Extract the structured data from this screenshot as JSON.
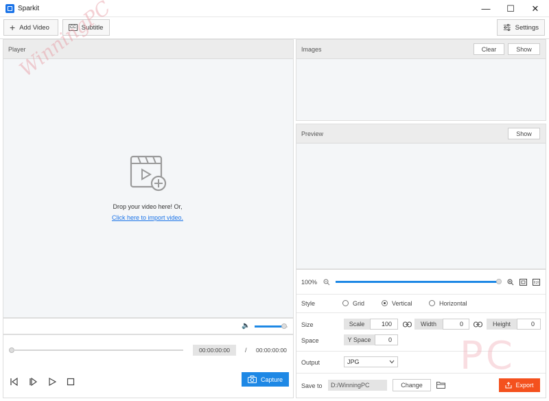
{
  "window": {
    "title": "Sparkit",
    "minimize": "—",
    "maximize": "☐",
    "close": "✕"
  },
  "toolbar": {
    "add_video": "Add Video",
    "subtitle": "Subtitle",
    "settings": "Settings"
  },
  "player": {
    "title": "Player",
    "drop_text": "Drop your video here! Or,",
    "import_link": "Click here to import video.",
    "current_time": "00:00:00:00",
    "separator": "/",
    "total_time": "00:00:00:00",
    "capture": "Capture",
    "volume_level": 0.9,
    "seek_progress": 0
  },
  "images": {
    "title": "Images",
    "clear": "Clear",
    "show": "Show"
  },
  "preview": {
    "title": "Preview",
    "show": "Show",
    "zoom": "100%",
    "zoom_level": 1.0
  },
  "settings": {
    "style_label": "Style",
    "style_options": [
      "Grid",
      "Vertical",
      "Horizontal"
    ],
    "style_selected": "Vertical",
    "size_label": "Size",
    "scale_label": "Scale",
    "scale_value": "100",
    "width_label": "Width",
    "width_value": "0",
    "height_label": "Height",
    "height_value": "0",
    "space_label": "Space",
    "yspace_label": "Y Space",
    "yspace_value": "0",
    "output_label": "Output",
    "output_value": "JPG",
    "saveto_label": "Save to",
    "saveto_value": "D:/WinningPC",
    "change": "Change",
    "export": "Export"
  },
  "watermarks": {
    "text": "WinningPC",
    "logo": "PC"
  },
  "colors": {
    "accent": "#1e88e5",
    "export": "#f4511e"
  }
}
